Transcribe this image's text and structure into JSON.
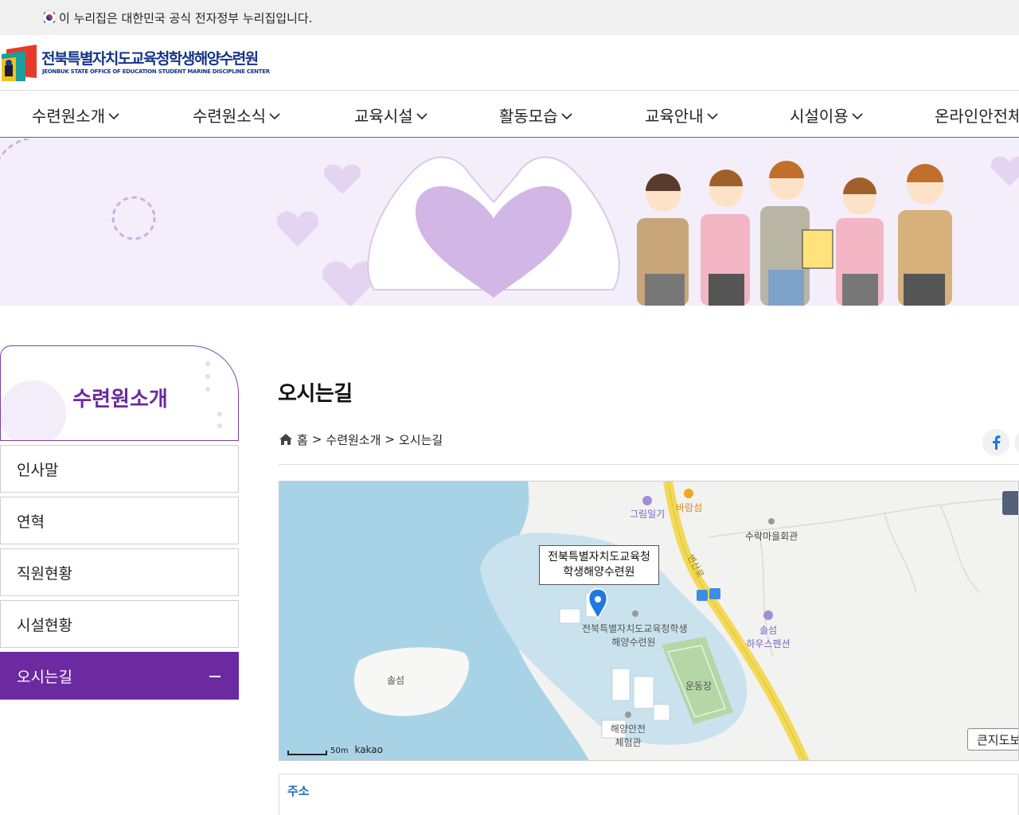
{
  "gov_banner": {
    "text": "이 누리집은 대한민국 공식 전자정부 누리집입니다."
  },
  "logo": {
    "title": "전북특별자치도교육청학생해양수련원",
    "subtitle": "JEONBUK STATE OFFICE  OF EDUCATION STUDENT MARINE DISCIPLINE CENTER"
  },
  "nav": {
    "items": [
      {
        "label": "수련원소개"
      },
      {
        "label": "수련원소식"
      },
      {
        "label": "교육시설"
      },
      {
        "label": "활동모습"
      },
      {
        "label": "교육안내"
      },
      {
        "label": "시설이용"
      },
      {
        "label": "온라인안전체"
      }
    ]
  },
  "sidebar": {
    "title": "수련원소개",
    "items": [
      {
        "label": "인사말",
        "active": false
      },
      {
        "label": "연혁",
        "active": false
      },
      {
        "label": "직원현황",
        "active": false
      },
      {
        "label": "시설현황",
        "active": false
      },
      {
        "label": "오시는길",
        "active": true
      }
    ]
  },
  "content": {
    "title": "오시는길",
    "breadcrumb": {
      "home": "홈",
      "sep": ">",
      "level1": "수련원소개",
      "level2": "오시는길"
    }
  },
  "map": {
    "card_line1": "전북특별자치도교육청",
    "card_line2": "학생해양수련원",
    "labels": {
      "geurim": "그림일기",
      "baramseom": "바람섬",
      "surak": "수락마을회관",
      "center_line1": "전북특별자치도교육청학생",
      "center_line2": "해양수련원",
      "solseom_pension_line1": "솔섬",
      "solseom_pension_line2": "하우스펜션",
      "solseom_island": "솔섬",
      "field": "운동장",
      "safety_line1": "해양안전",
      "safety_line2": "체험관",
      "road": "변산로"
    },
    "scale": "50m",
    "brand": "kakao",
    "big_map_button": "큰지도보기"
  },
  "address": {
    "label": "주소"
  },
  "colors": {
    "primary_purple": "#6c2aa1",
    "logo_navy": "#15348a",
    "map_sea": "#a8d3e6",
    "map_road": "#f2d957",
    "address_label": "#1f6fb8"
  }
}
